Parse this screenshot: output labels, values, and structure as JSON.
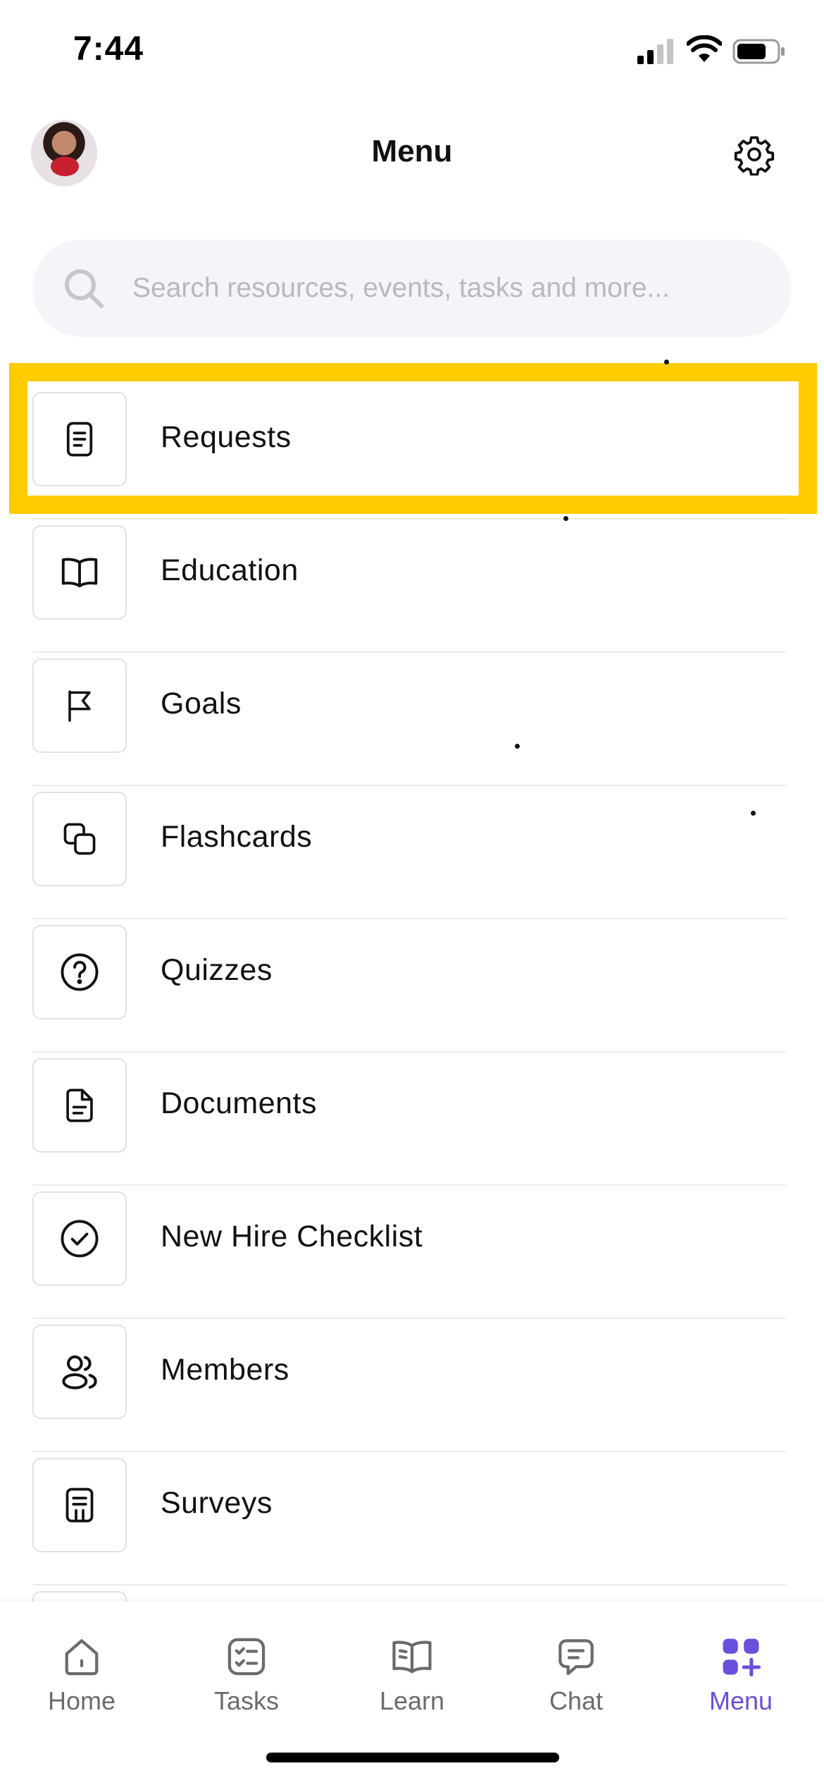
{
  "status_bar": {
    "time": "7:44"
  },
  "header": {
    "title": "Menu"
  },
  "search": {
    "placeholder": "Search resources, events, tasks and more..."
  },
  "menu": {
    "items": [
      {
        "label": "Requests",
        "icon": "document-list-icon"
      },
      {
        "label": "Education",
        "icon": "open-book-icon"
      },
      {
        "label": "Goals",
        "icon": "flag-icon"
      },
      {
        "label": "Flashcards",
        "icon": "copy-cards-icon"
      },
      {
        "label": "Quizzes",
        "icon": "question-circle-icon"
      },
      {
        "label": "Documents",
        "icon": "file-text-icon"
      },
      {
        "label": "New Hire Checklist",
        "icon": "check-circle-icon"
      },
      {
        "label": "Members",
        "icon": "users-icon"
      },
      {
        "label": "Surveys",
        "icon": "survey-form-icon"
      }
    ]
  },
  "tab_bar": {
    "tabs": [
      {
        "label": "Home",
        "icon": "home-icon"
      },
      {
        "label": "Tasks",
        "icon": "tasks-checklist-icon"
      },
      {
        "label": "Learn",
        "icon": "book-icon"
      },
      {
        "label": "Chat",
        "icon": "chat-bubble-icon"
      },
      {
        "label": "Menu",
        "icon": "grid-plus-icon",
        "active": true
      }
    ]
  },
  "colors": {
    "accent": "#6a4fdc",
    "highlight": "#ffcc00",
    "search_bg": "#f4f5f9"
  }
}
